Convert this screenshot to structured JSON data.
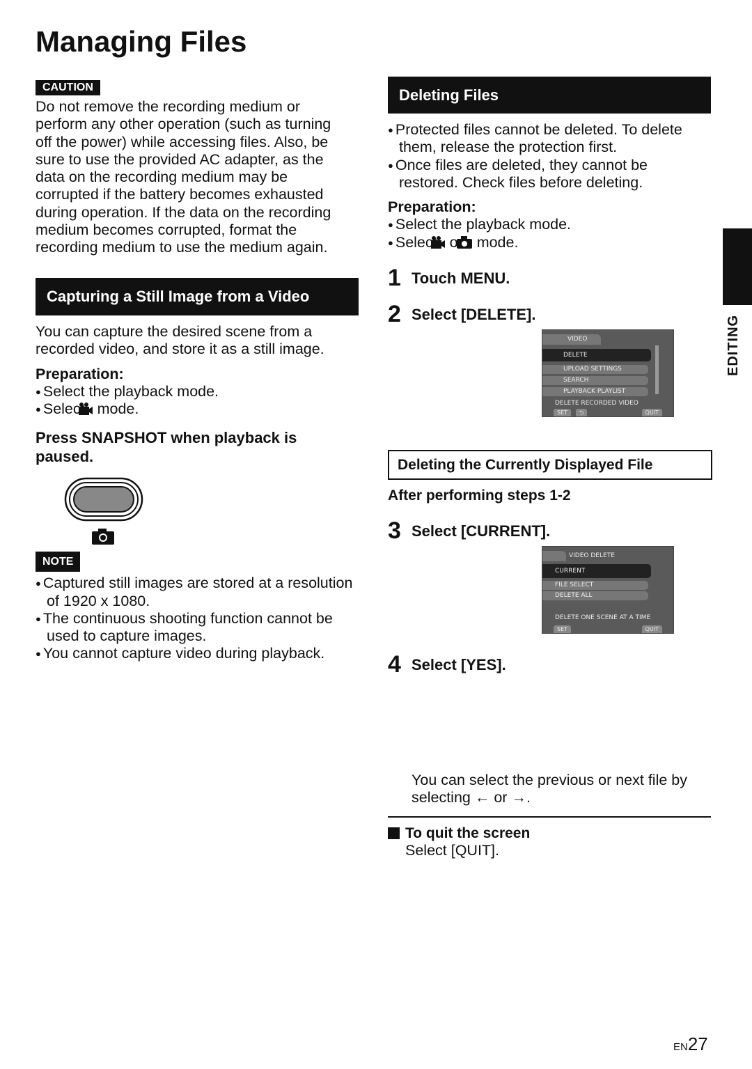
{
  "title": "Managing Files",
  "caution": {
    "tag": "CAUTION",
    "text": "Do not remove the recording medium or perform any other operation (such as turning off the power) while accessing files. Also, be sure to use the provided AC adapter, as the data on the recording medium may be corrupted if the battery becomes exhausted during operation. If the data on the recording medium becomes corrupted, format the recording medium to use the medium again."
  },
  "capture": {
    "heading": "Capturing a Still Image from a Video",
    "intro": "You can capture the desired scene from a recorded video, and store it as a still image.",
    "prep_label": "Preparation:",
    "prep": [
      "Select the playback mode.",
      "Select",
      "mode."
    ],
    "instruction": "Press SNAPSHOT when playback is paused.",
    "note_tag": "NOTE",
    "notes": [
      "Captured still images are stored at a resolution of 1920 x 1080.",
      "The continuous shooting function cannot be used to capture images.",
      "You cannot capture video during playback."
    ]
  },
  "delete": {
    "heading": "Deleting Files",
    "bullets": [
      "Protected files cannot be deleted. To delete them, release the protection first.",
      "Once files are deleted, they cannot be restored. Check files before deleting."
    ],
    "prep_label": "Preparation:",
    "prep": [
      "Select the playback mode.",
      "Select",
      "or",
      "mode."
    ],
    "steps": [
      {
        "n": "1",
        "text": "Touch MENU."
      },
      {
        "n": "2",
        "text": "Select [DELETE]."
      },
      {
        "n": "3",
        "text": "Select [CURRENT]."
      },
      {
        "n": "4",
        "text": "Select [YES]."
      }
    ],
    "menu1": {
      "tab": "VIDEO",
      "items": [
        "DELETE",
        "UPLOAD SETTINGS",
        "SEARCH",
        "PLAYBACK PLAYLIST"
      ],
      "hint": "DELETE RECORDED VIDEO",
      "set": "SET",
      "back": "⮌",
      "quit": "QUIT"
    },
    "sub_heading": "Deleting the Currently Displayed File",
    "after": "After performing steps 1-2",
    "menu2": {
      "tab": "VIDEO DELETE",
      "items": [
        "CURRENT",
        "FILE SELECT",
        "DELETE ALL"
      ],
      "hint": "DELETE ONE SCENE AT A TIME",
      "set": "SET",
      "quit": "QUIT"
    },
    "prev_next": [
      "You can select the previous or next file by selecting",
      "or",
      "."
    ],
    "quit_title": "To quit the screen",
    "quit_text": "Select [QUIT]."
  },
  "side_tab": "EDITING",
  "footer": {
    "lang": "EN",
    "page": "27"
  }
}
